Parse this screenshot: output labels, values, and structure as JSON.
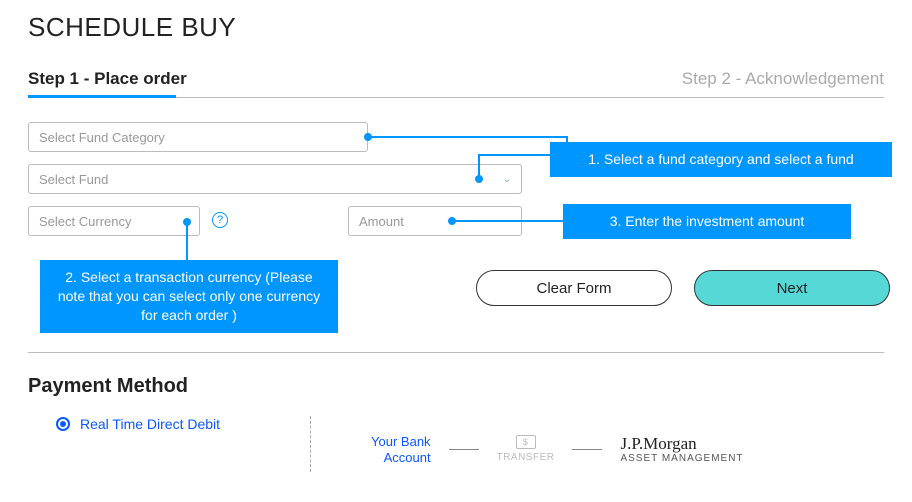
{
  "title": "SCHEDULE BUY",
  "steps": {
    "step1": "Step 1 - Place order",
    "step2": "Step 2 - Acknowledgement"
  },
  "form": {
    "fund_category_placeholder": "Select Fund Category",
    "fund_placeholder": "Select Fund",
    "currency_placeholder": "Select Currency",
    "amount_placeholder": "Amount",
    "help_icon": "?"
  },
  "callouts": {
    "c1": "1. Select a fund category and select a fund",
    "c2": "2. Select a transaction currency (Please note that you can select only one currency for  each order )",
    "c3": "3. Enter the investment amount"
  },
  "buttons": {
    "clear": "Clear Form",
    "next": "Next"
  },
  "payment": {
    "section_title": "Payment Method",
    "option_label": "Real Time Direct Debit",
    "bank_label_line1": "Your Bank",
    "bank_label_line2": "Account",
    "transfer_symbol": "$",
    "transfer_label": "TRANSFER",
    "jpm_top": "J.P.Morgan",
    "jpm_sub": "ASSET MANAGEMENT"
  }
}
